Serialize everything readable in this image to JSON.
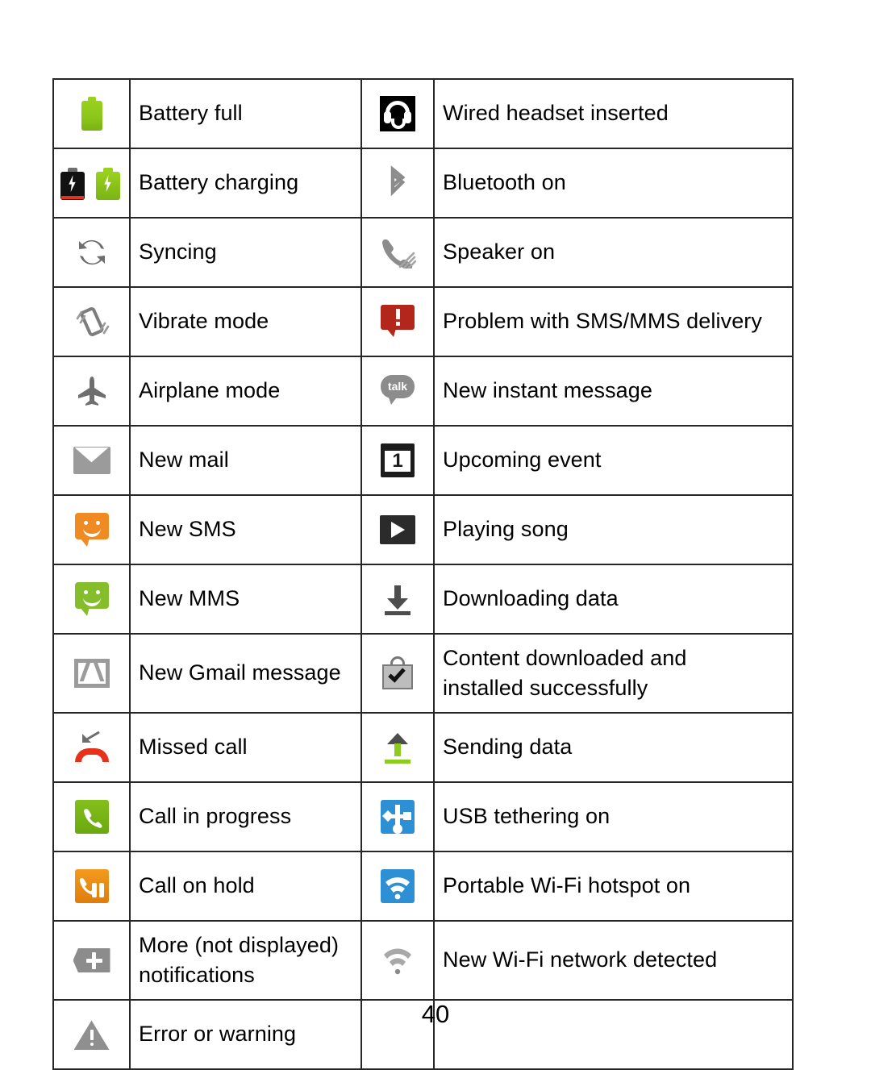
{
  "document": {
    "page_number": "40"
  },
  "table": {
    "rows": [
      {
        "left": {
          "icon": "battery-full-icon",
          "label": "Battery full"
        },
        "right": {
          "icon": "wired-headset-icon",
          "label": "Wired headset inserted"
        }
      },
      {
        "left": {
          "icon": "battery-charging-icon",
          "label": "Battery charging"
        },
        "right": {
          "icon": "bluetooth-icon",
          "label": "Bluetooth on"
        }
      },
      {
        "left": {
          "icon": "sync-icon",
          "label": "Syncing"
        },
        "right": {
          "icon": "speakerphone-icon",
          "label": "Speaker on"
        }
      },
      {
        "left": {
          "icon": "vibrate-icon",
          "label": "Vibrate mode"
        },
        "right": {
          "icon": "sms-problem-icon",
          "label": "Problem with SMS/MMS delivery"
        }
      },
      {
        "left": {
          "icon": "airplane-mode-icon",
          "label": "Airplane mode"
        },
        "right": {
          "icon": "talk-icon",
          "label": "New instant message"
        }
      },
      {
        "left": {
          "icon": "new-mail-icon",
          "label": "New mail"
        },
        "right": {
          "icon": "calendar-event-icon",
          "label": "Upcoming event"
        }
      },
      {
        "left": {
          "icon": "new-sms-icon",
          "label": "New SMS"
        },
        "right": {
          "icon": "play-icon",
          "label": "Playing song"
        }
      },
      {
        "left": {
          "icon": "new-mms-icon",
          "label": "New MMS"
        },
        "right": {
          "icon": "download-icon",
          "label": "Downloading data"
        }
      },
      {
        "left": {
          "icon": "gmail-icon",
          "label": "New Gmail message"
        },
        "right": {
          "icon": "install-complete-icon",
          "label": "Content downloaded and",
          "label_line2": "installed successfully"
        }
      },
      {
        "left": {
          "icon": "missed-call-icon",
          "label": "Missed call"
        },
        "right": {
          "icon": "upload-icon",
          "label": "Sending data"
        }
      },
      {
        "left": {
          "icon": "call-in-progress-icon",
          "label": "Call in progress"
        },
        "right": {
          "icon": "usb-tethering-icon",
          "label": "USB tethering on"
        }
      },
      {
        "left": {
          "icon": "call-on-hold-icon",
          "label": "Call on hold"
        },
        "right": {
          "icon": "wifi-hotspot-icon",
          "label": "Portable Wi-Fi hotspot on"
        }
      },
      {
        "left": {
          "icon": "more-notifications-icon",
          "label": "More (not displayed)",
          "label_line2": "notifications"
        },
        "right": {
          "icon": "wifi-detected-icon",
          "label": "New Wi-Fi network detected"
        }
      },
      {
        "left": {
          "icon": "warning-icon",
          "label": "Error or warning"
        },
        "right": {
          "icon": "",
          "label": ""
        }
      }
    ]
  },
  "colors": {
    "border": "#262626",
    "battery_green": "#9ad11f",
    "sms_orange": "#ef8b22",
    "mms_green": "#86bd2b",
    "alert_red": "#b3261c",
    "missed_call_red": "#e8311a",
    "call_green": "#84c01c",
    "call_hold_orange": "#f29a1f",
    "blue": "#2d8fd4",
    "gray": "#8c8c8c"
  },
  "talk_icon_text": "talk",
  "calendar_day": "1"
}
